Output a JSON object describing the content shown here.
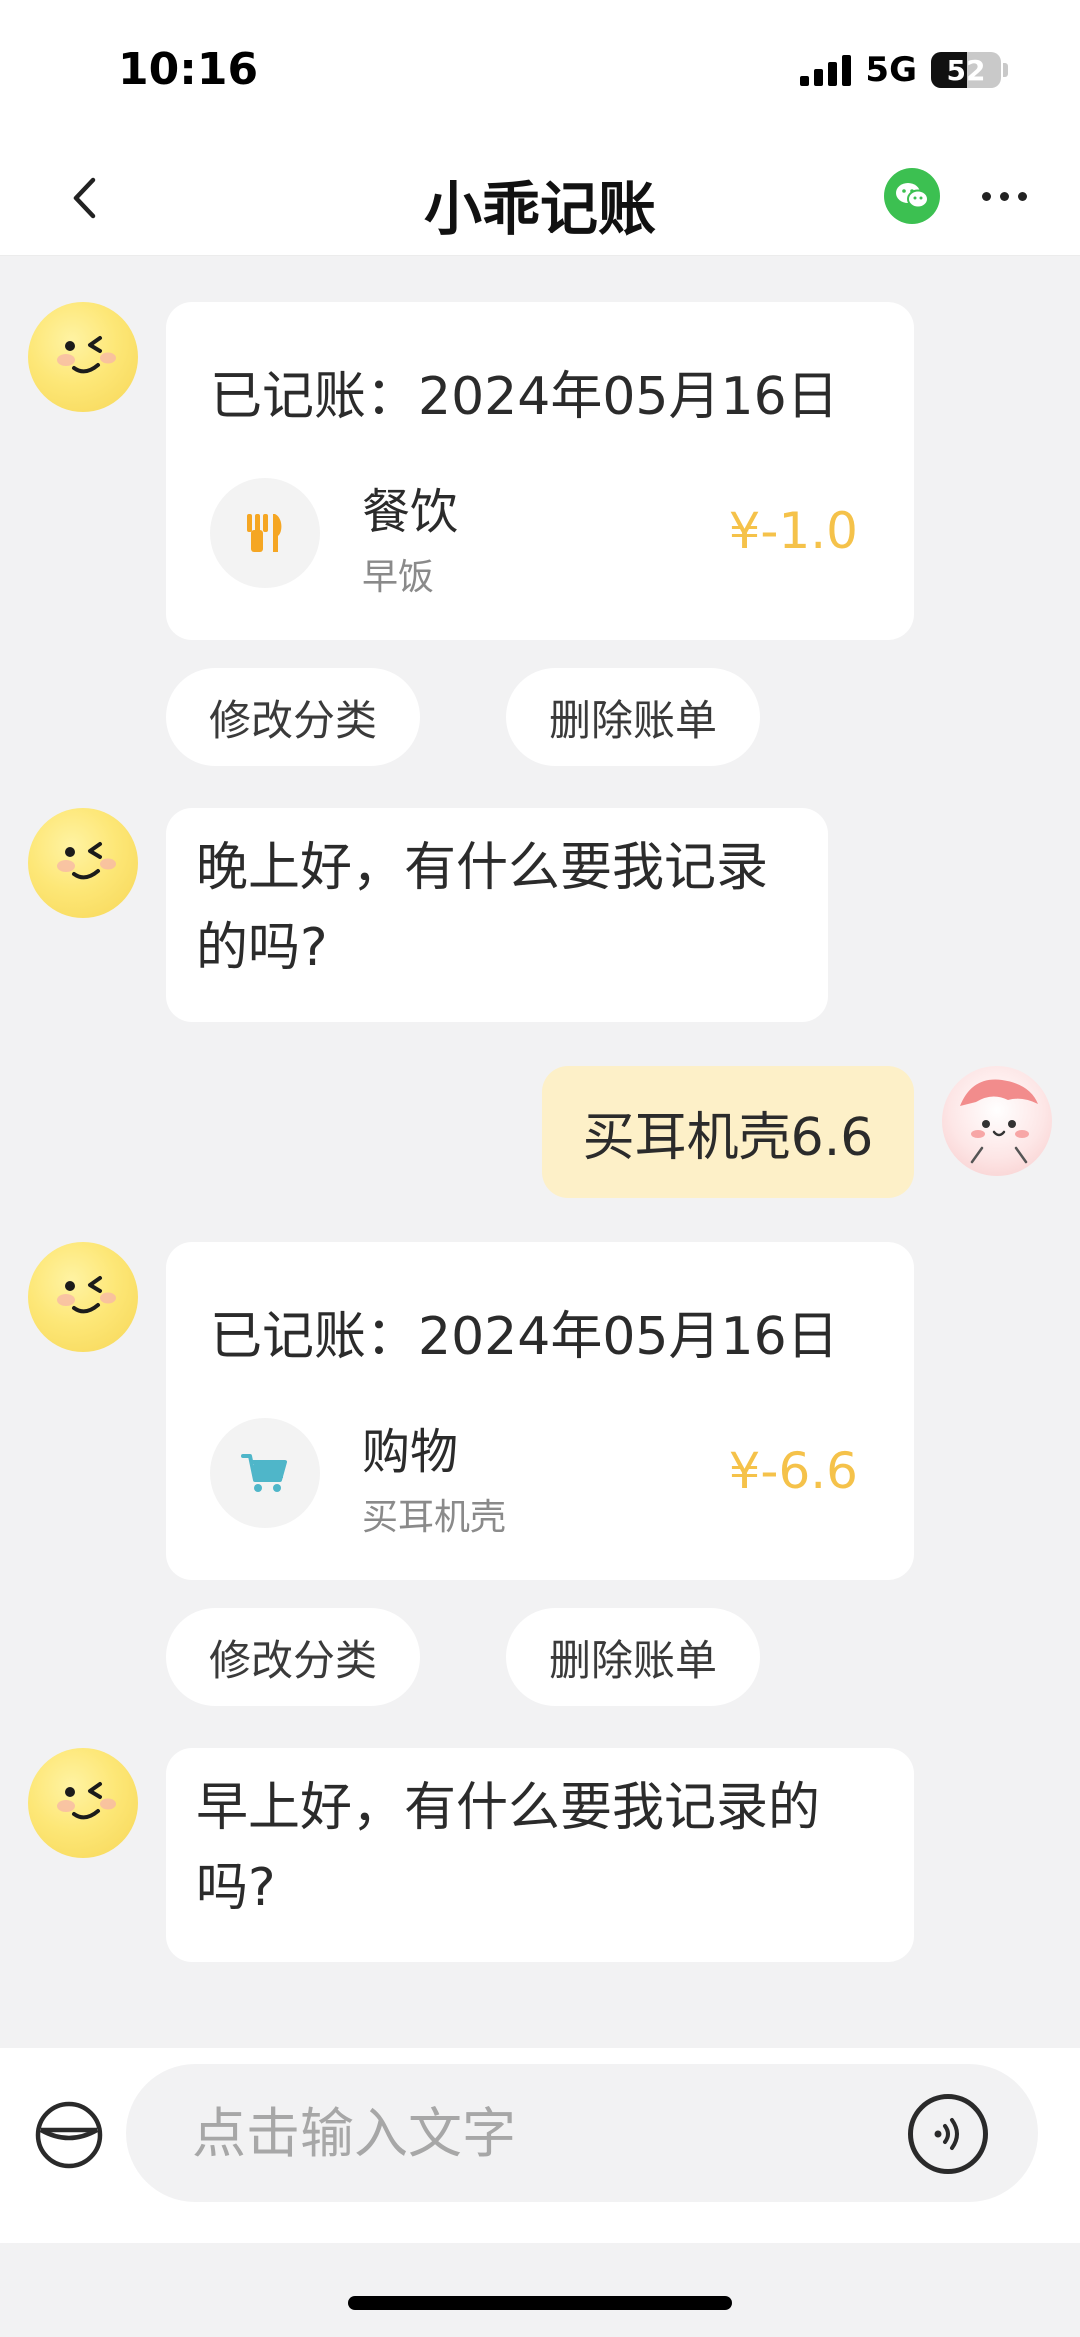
{
  "status_bar": {
    "time": "10:16",
    "network": "5G",
    "battery": "52",
    "battery_level": 0.52
  },
  "nav": {
    "title": "小乖记账",
    "back_icon": "chevron-left-icon",
    "wechat_icon": "wechat-icon",
    "more_icon": "more-dots-icon"
  },
  "messages": [
    {
      "type": "bill",
      "title": "已记账：2024年05月16日",
      "category": "餐饮",
      "note": "早饭",
      "amount": "¥-1.0",
      "icon": "fork-knife-icon",
      "actions": [
        "修改分类",
        "删除账单"
      ]
    },
    {
      "type": "bot_text",
      "text": "晚上好，有什么要我记录的吗?"
    },
    {
      "type": "user_text",
      "text": "买耳机壳6.6"
    },
    {
      "type": "bill",
      "title": "已记账：2024年05月16日",
      "category": "购物",
      "note": "买耳机壳",
      "amount": "¥-6.6",
      "icon": "shopping-cart-icon",
      "actions": [
        "修改分类",
        "删除账单"
      ]
    },
    {
      "type": "bot_text",
      "text": "早上好，有什么要我记录的吗?"
    }
  ],
  "input": {
    "placeholder": "点击输入文字",
    "wallet_icon": "wallet-icon",
    "voice_icon": "voice-icon"
  },
  "colors": {
    "amount": "#f5c24a",
    "user_bubble": "#fdf0c8",
    "wechat": "#3cc051",
    "background": "#f2f2f3"
  }
}
